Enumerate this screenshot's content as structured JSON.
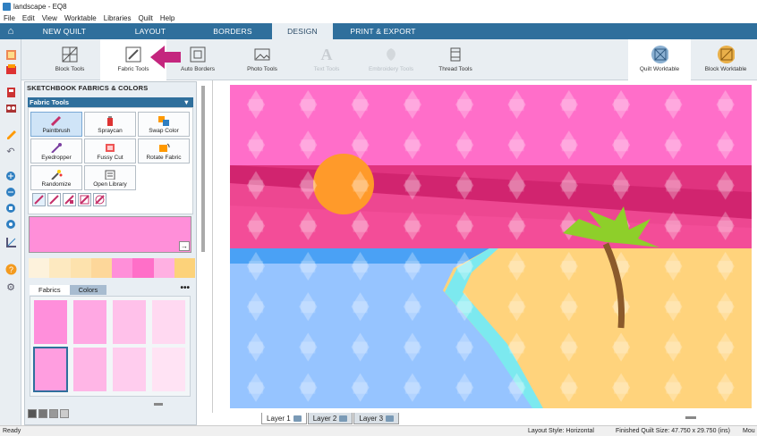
{
  "window": {
    "title": "landscape - EQ8"
  },
  "menu": [
    "File",
    "Edit",
    "View",
    "Worktable",
    "Libraries",
    "Quilt",
    "Help"
  ],
  "tabs": [
    "NEW QUILT",
    "LAYOUT",
    "BORDERS",
    "DESIGN",
    "PRINT & EXPORT"
  ],
  "ribbon": {
    "block_tools": "Block Tools",
    "fabric_tools": "Fabric Tools",
    "auto_borders": "Auto Borders",
    "photo_tools": "Photo Tools",
    "text_tools": "Text Tools",
    "embroidery_tools": "Embroidery Tools",
    "thread_tools": "Thread Tools",
    "quilt_worktable": "Quilt Worktable",
    "block_worktable": "Block Worktable"
  },
  "panel": {
    "title": "SKETCHBOOK FABRICS & COLORS",
    "section": "Fabric Tools",
    "tools": [
      "Paintbrush",
      "Spraycan",
      "Swap Color",
      "Eyedropper",
      "Fussy Cut",
      "Rotate Fabric",
      "Randomize",
      "Open Library"
    ],
    "tabs": {
      "fabrics": "Fabrics",
      "colors": "Colors"
    },
    "selected_color": "#ff8fd9",
    "swatch_row": [
      "#fdf2dc",
      "#fde9c0",
      "#fde2ad",
      "#fdd79a",
      "#ff8fd9",
      "#ff6fc8",
      "#ffb0e2",
      "#fcd27a"
    ],
    "grid": [
      "#ff8fdb",
      "#ffa8e3",
      "#ffc1ea",
      "#ffd9f1",
      "#ff9ee0",
      "#ffb6e6",
      "#ffcdee",
      "#ffe3f4"
    ]
  },
  "layers": [
    "Layer 1",
    "Layer 2",
    "Layer 3"
  ],
  "status": {
    "ready": "Ready",
    "layout": "Layout Style: Horizontal",
    "size": "Finished Quilt Size: 47.750 x 29.750 (ins)",
    "mouse": "Mou"
  }
}
